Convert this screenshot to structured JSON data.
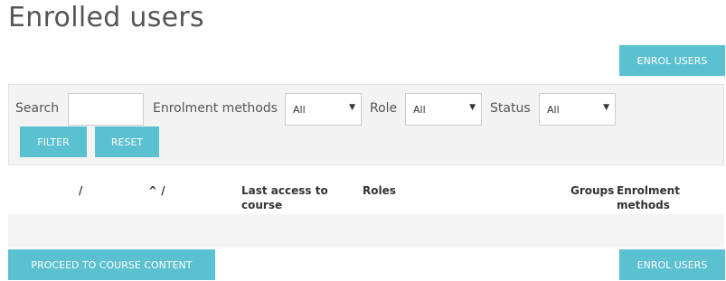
{
  "page": {
    "title": "Enrolled users",
    "enrol_button_top": "ENROL USERS",
    "enrol_button_bottom": "ENROL USERS",
    "proceed_button": "PROCEED TO COURSE CONTENT"
  },
  "filters": {
    "search_label": "Search",
    "search_value": "",
    "enrolment_methods_label": "Enrolment methods",
    "enrolment_methods_value": "All",
    "role_label": "Role",
    "role_value": "All",
    "status_label": "Status",
    "status_value": "All",
    "filter_button": "FILTER",
    "reset_button": "RESET"
  },
  "table": {
    "columns": {
      "col1": "/",
      "col2": "^ /",
      "last_access_line1": "Last access to",
      "last_access_line2": "course",
      "roles": "Roles",
      "groups": "Groups",
      "enrolment_methods_line1": "Enrolment",
      "enrolment_methods_line2": "methods"
    }
  },
  "colors": {
    "button": "#5bc0d0",
    "panel": "#f3f3f3"
  }
}
